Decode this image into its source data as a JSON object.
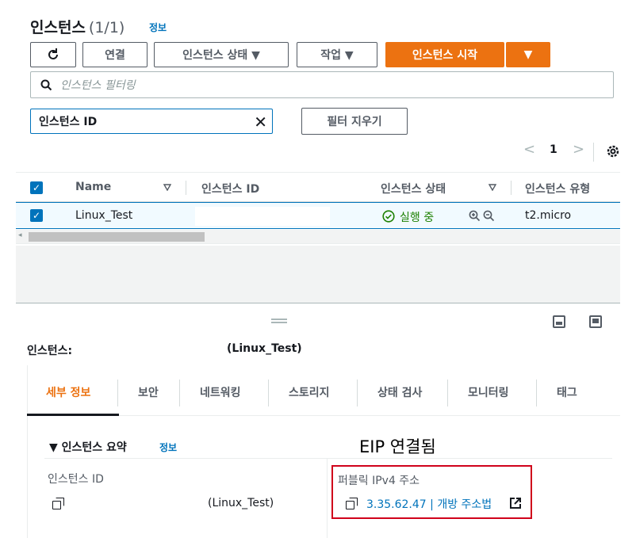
{
  "header": {
    "title": "인스턴스",
    "count": "(1/1)",
    "info": "정보"
  },
  "toolbar": {
    "connect": "연결",
    "instance_state": "인스턴스 상태 ▼",
    "actions": "작업 ▼",
    "launch": "인스턴스 시작",
    "launch_dropdown": "▼"
  },
  "search": {
    "placeholder": "인스턴스 필터링"
  },
  "filter": {
    "token": "인스턴스 ID",
    "clear": "필터 지우기"
  },
  "pager": {
    "prev": "<",
    "page": "1",
    "next": ">"
  },
  "table": {
    "headers": [
      "Name",
      "인스턴스 ID",
      "인스턴스 상태",
      "인스턴스 유형"
    ],
    "row": {
      "name": "Linux_Test",
      "instance_id": "",
      "state": "실행 중",
      "type": "t2.micro"
    }
  },
  "panel": {
    "label": "인스턴스:",
    "name": "(Linux_Test)",
    "tabs": [
      "세부 정보",
      "보안",
      "네트워킹",
      "스토리지",
      "상태 검사",
      "모니터링",
      "태그"
    ],
    "summary_title": "▼ 인스턴스 요약",
    "summary_info": "정보",
    "annotation": "EIP 연결됨",
    "instance_id_label": "인스턴스 ID",
    "instance_id_value": "(Linux_Test)",
    "public_ip_label": "퍼블릭 IPv4 주소",
    "public_ip_value": "3.35.62.47 | 개방 주소법"
  },
  "colors": {
    "accent": "#ec7211",
    "link": "#0073bb",
    "running": "#1d8102",
    "highlight_box": "#d0021b"
  }
}
